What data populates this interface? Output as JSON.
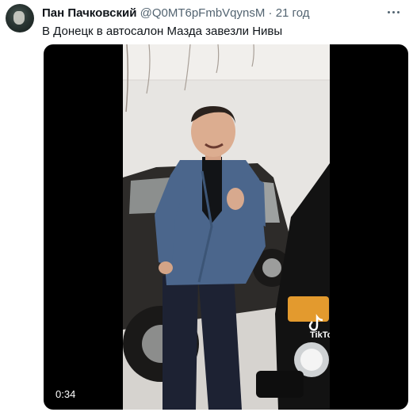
{
  "tweet": {
    "author": {
      "display_name": "Пан Пачковский",
      "handle": "@Q0MT6pFmbVqynsM",
      "avatar_icon": "avatar-image"
    },
    "separator": "·",
    "timestamp": "21 год",
    "more_icon": "more-dots-icon",
    "text": "В Донецк в автосалон Мазда завезли Нивы",
    "media": {
      "type": "video",
      "duration": "0:34",
      "watermark_icon": "tiktok-logo"
    }
  },
  "colors": {
    "text_primary": "#0f1419",
    "text_secondary": "#536471",
    "media_background": "#000000"
  }
}
